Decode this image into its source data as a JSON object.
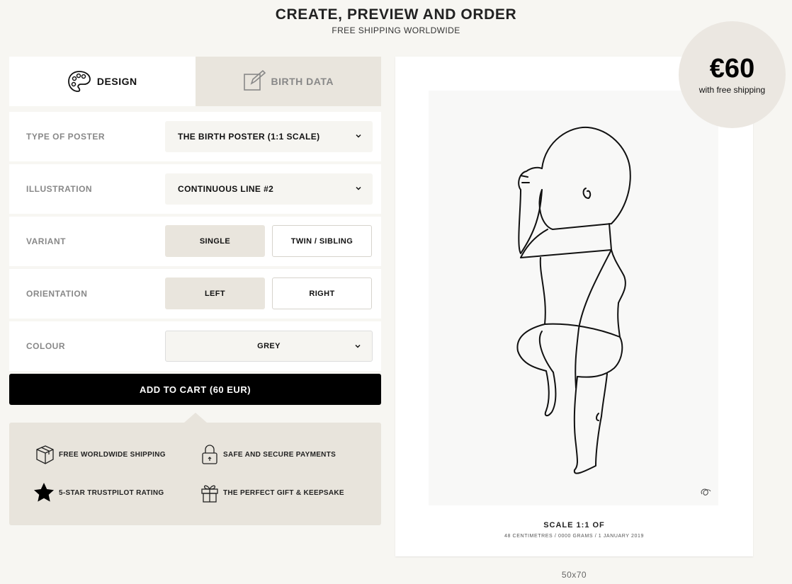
{
  "header": {
    "title": "CREATE, PREVIEW AND ORDER",
    "subtitle": "FREE SHIPPING WORLDWIDE"
  },
  "tabs": [
    {
      "label": "DESIGN",
      "icon": "palette-icon",
      "active": true
    },
    {
      "label": "BIRTH DATA",
      "icon": "edit-icon",
      "active": false
    }
  ],
  "form": {
    "type_of_poster": {
      "label": "TYPE OF POSTER",
      "value": "THE BIRTH POSTER (1:1 SCALE)"
    },
    "illustration": {
      "label": "ILLUSTRATION",
      "value": "CONTINUOUS LINE #2"
    },
    "variant": {
      "label": "VARIANT",
      "options": [
        "SINGLE",
        "TWIN / SIBLING"
      ],
      "selected": "SINGLE"
    },
    "orientation": {
      "label": "ORIENTATION",
      "options": [
        "LEFT",
        "RIGHT"
      ],
      "selected": "LEFT"
    },
    "colour": {
      "label": "COLOUR",
      "value": "GREY"
    }
  },
  "cart_button": "ADD TO CART (60 EUR)",
  "perks": [
    {
      "icon": "box-icon",
      "label": "FREE WORLDWIDE SHIPPING"
    },
    {
      "icon": "lock-icon",
      "label": "SAFE AND SECURE PAYMENTS"
    },
    {
      "icon": "star-icon",
      "label": "5-STAR TRUSTPILOT RATING"
    },
    {
      "icon": "gift-icon",
      "label": "THE PERFECT GIFT & KEEPSAKE"
    }
  ],
  "preview": {
    "scale_text": "SCALE 1:1 OF",
    "details": "48 CENTIMETRES / 0000 GRAMS / 1 JANUARY 2019",
    "size": "50x70"
  },
  "price": {
    "amount": "€60",
    "note": "with free shipping"
  },
  "colors": {
    "accent_bg": "#e9e5dd",
    "button": "#000000",
    "page_bg": "#f7f6f2"
  }
}
